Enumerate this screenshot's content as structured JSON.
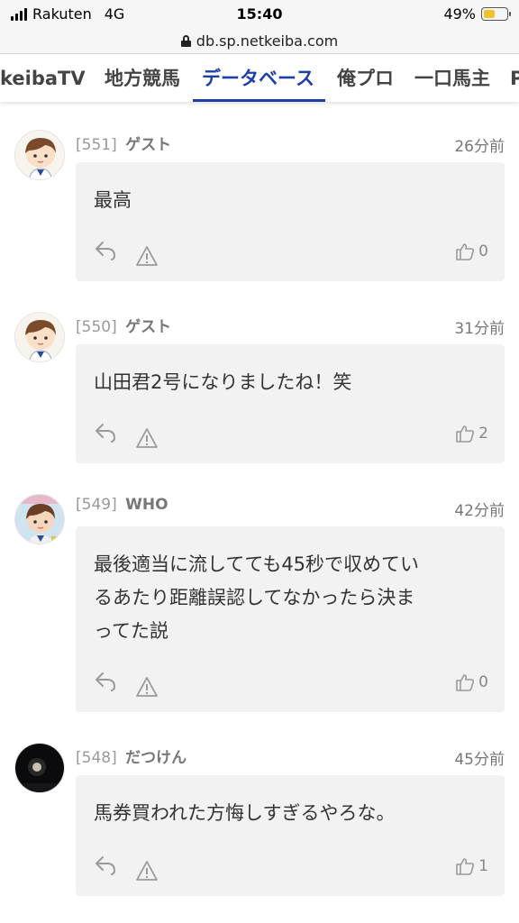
{
  "status_bar": {
    "carrier": "Rakuten",
    "network": "4G",
    "time": "15:40",
    "battery": "49%",
    "battery_level": 0.49
  },
  "browser": {
    "url": "db.sp.netkeiba.com"
  },
  "tabs": [
    {
      "label": "keibaTV",
      "active": false
    },
    {
      "label": "地方競馬",
      "active": false
    },
    {
      "label": "データベース",
      "active": true
    },
    {
      "label": "俺プロ",
      "active": false
    },
    {
      "label": "一口馬主",
      "active": false
    },
    {
      "label": "P",
      "active": false
    }
  ],
  "comments": [
    {
      "num": "[551]",
      "user": "ゲスト",
      "time": "26分前",
      "text": "最高",
      "likes": "0",
      "avatar": "child-icon"
    },
    {
      "num": "[550]",
      "user": "ゲスト",
      "time": "31分前",
      "text": "山田君2号になりましたね！笑",
      "likes": "2",
      "avatar": "child-icon"
    },
    {
      "num": "[549]",
      "user": "WHO",
      "time": "42分前",
      "lines": [
        "最後適当に流してても45秒で収めてい",
        "るあたり距離誤認してなかったら決ま",
        "ってた説"
      ],
      "likes": "0",
      "avatar": "child-photo"
    },
    {
      "num": "[548]",
      "user": "だつけん",
      "time": "45分前",
      "text": "馬券買われた方悔しすぎるやろな。",
      "likes": "1",
      "avatar": "night-photo"
    }
  ],
  "colors": {
    "accent": "#1e3fa6",
    "bubble": "#f2f2f2",
    "battery": "#f3c12e"
  }
}
